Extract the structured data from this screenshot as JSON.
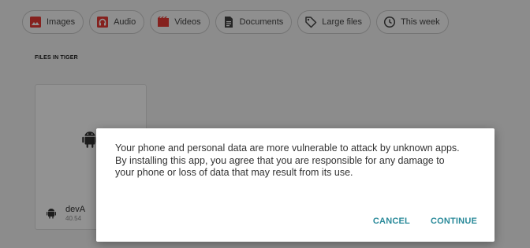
{
  "filters": [
    {
      "label": "Images",
      "icon": "images-icon",
      "color": "#e53935"
    },
    {
      "label": "Audio",
      "icon": "audio-icon",
      "color": "#e53935"
    },
    {
      "label": "Videos",
      "icon": "videos-icon",
      "color": "#e53935"
    },
    {
      "label": "Documents",
      "icon": "document-icon",
      "color": "#424242"
    },
    {
      "label": "Large files",
      "icon": "tag-icon",
      "color": "#424242"
    },
    {
      "label": "This week",
      "icon": "clock-icon",
      "color": "#424242"
    }
  ],
  "section_title": "FILES IN TIGER",
  "file": {
    "name": "devA",
    "size": "40.54",
    "icon": "android-icon"
  },
  "dialog": {
    "message": "Your phone and personal data are more vulnerable to attack by unknown apps. By installing this app, you agree that you are responsible for any damage to your phone or loss of data that may result from its use.",
    "cancel": "CANCEL",
    "continue": "CONTINUE",
    "accent": "#2a8a9a"
  }
}
